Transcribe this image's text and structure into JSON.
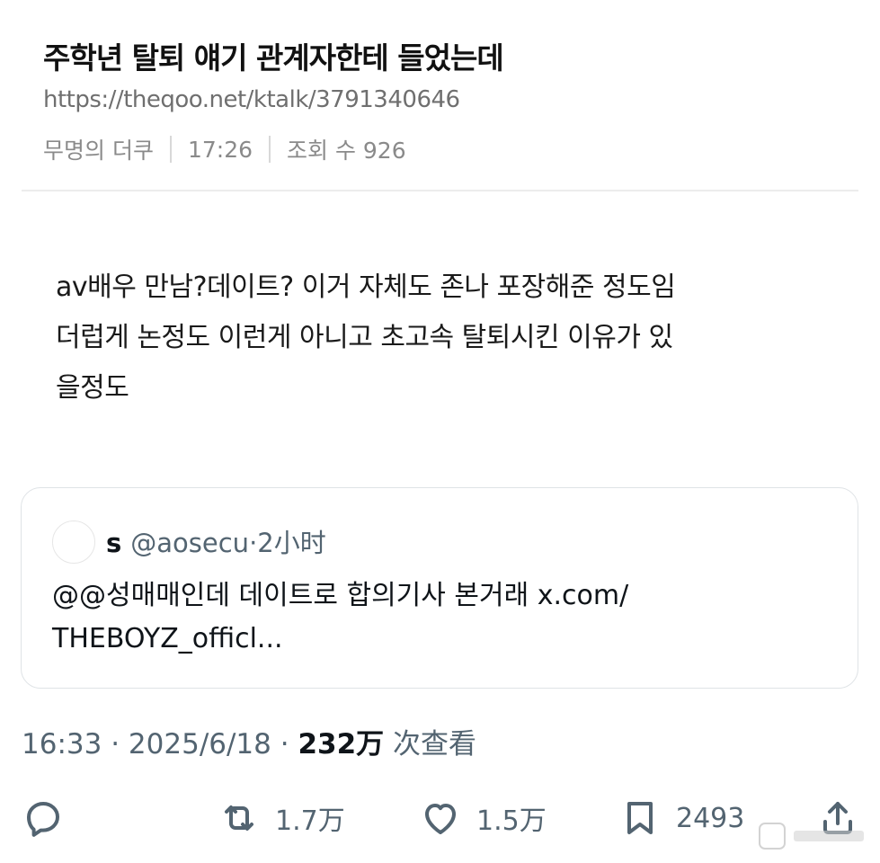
{
  "article": {
    "title": "주학년 탈퇴 얘기 관계자한테 들었는데",
    "url": "https://theqoo.net/ktalk/3791340646",
    "author": "무명의 더쿠",
    "time": "17:26",
    "views": "조회 수 926",
    "body_lines": [
      "av배우 만남?데이트? 이거 자체도 존나 포장해준 정도임",
      "더럽게 논정도 이런게 아니고 초고속 탈퇴시킨 이유가 있",
      "을정도"
    ]
  },
  "quote": {
    "name": "s",
    "handle": "@aosecu",
    "dot": "·",
    "time": "2小时",
    "text_lines": [
      "@@성매매인데 데이트로 합의기사 본거래 x.com/",
      "THEBOYZ_officl..."
    ]
  },
  "meta": {
    "time": "16:33",
    "date": "2025/6/18",
    "sep": "·",
    "views_count": "232万",
    "views_label": "次查看"
  },
  "actions": {
    "replies": "",
    "retweets": "1.7万",
    "likes": "1.5万",
    "bookmarks": "2493"
  },
  "icons": {
    "reply": "reply-icon",
    "retweet": "retweet-icon",
    "like": "heart-icon",
    "bookmark": "bookmark-icon",
    "share": "share-icon"
  },
  "colors": {
    "text_primary": "#0f1419",
    "text_secondary": "#536471",
    "border": "#dfe3e6"
  }
}
